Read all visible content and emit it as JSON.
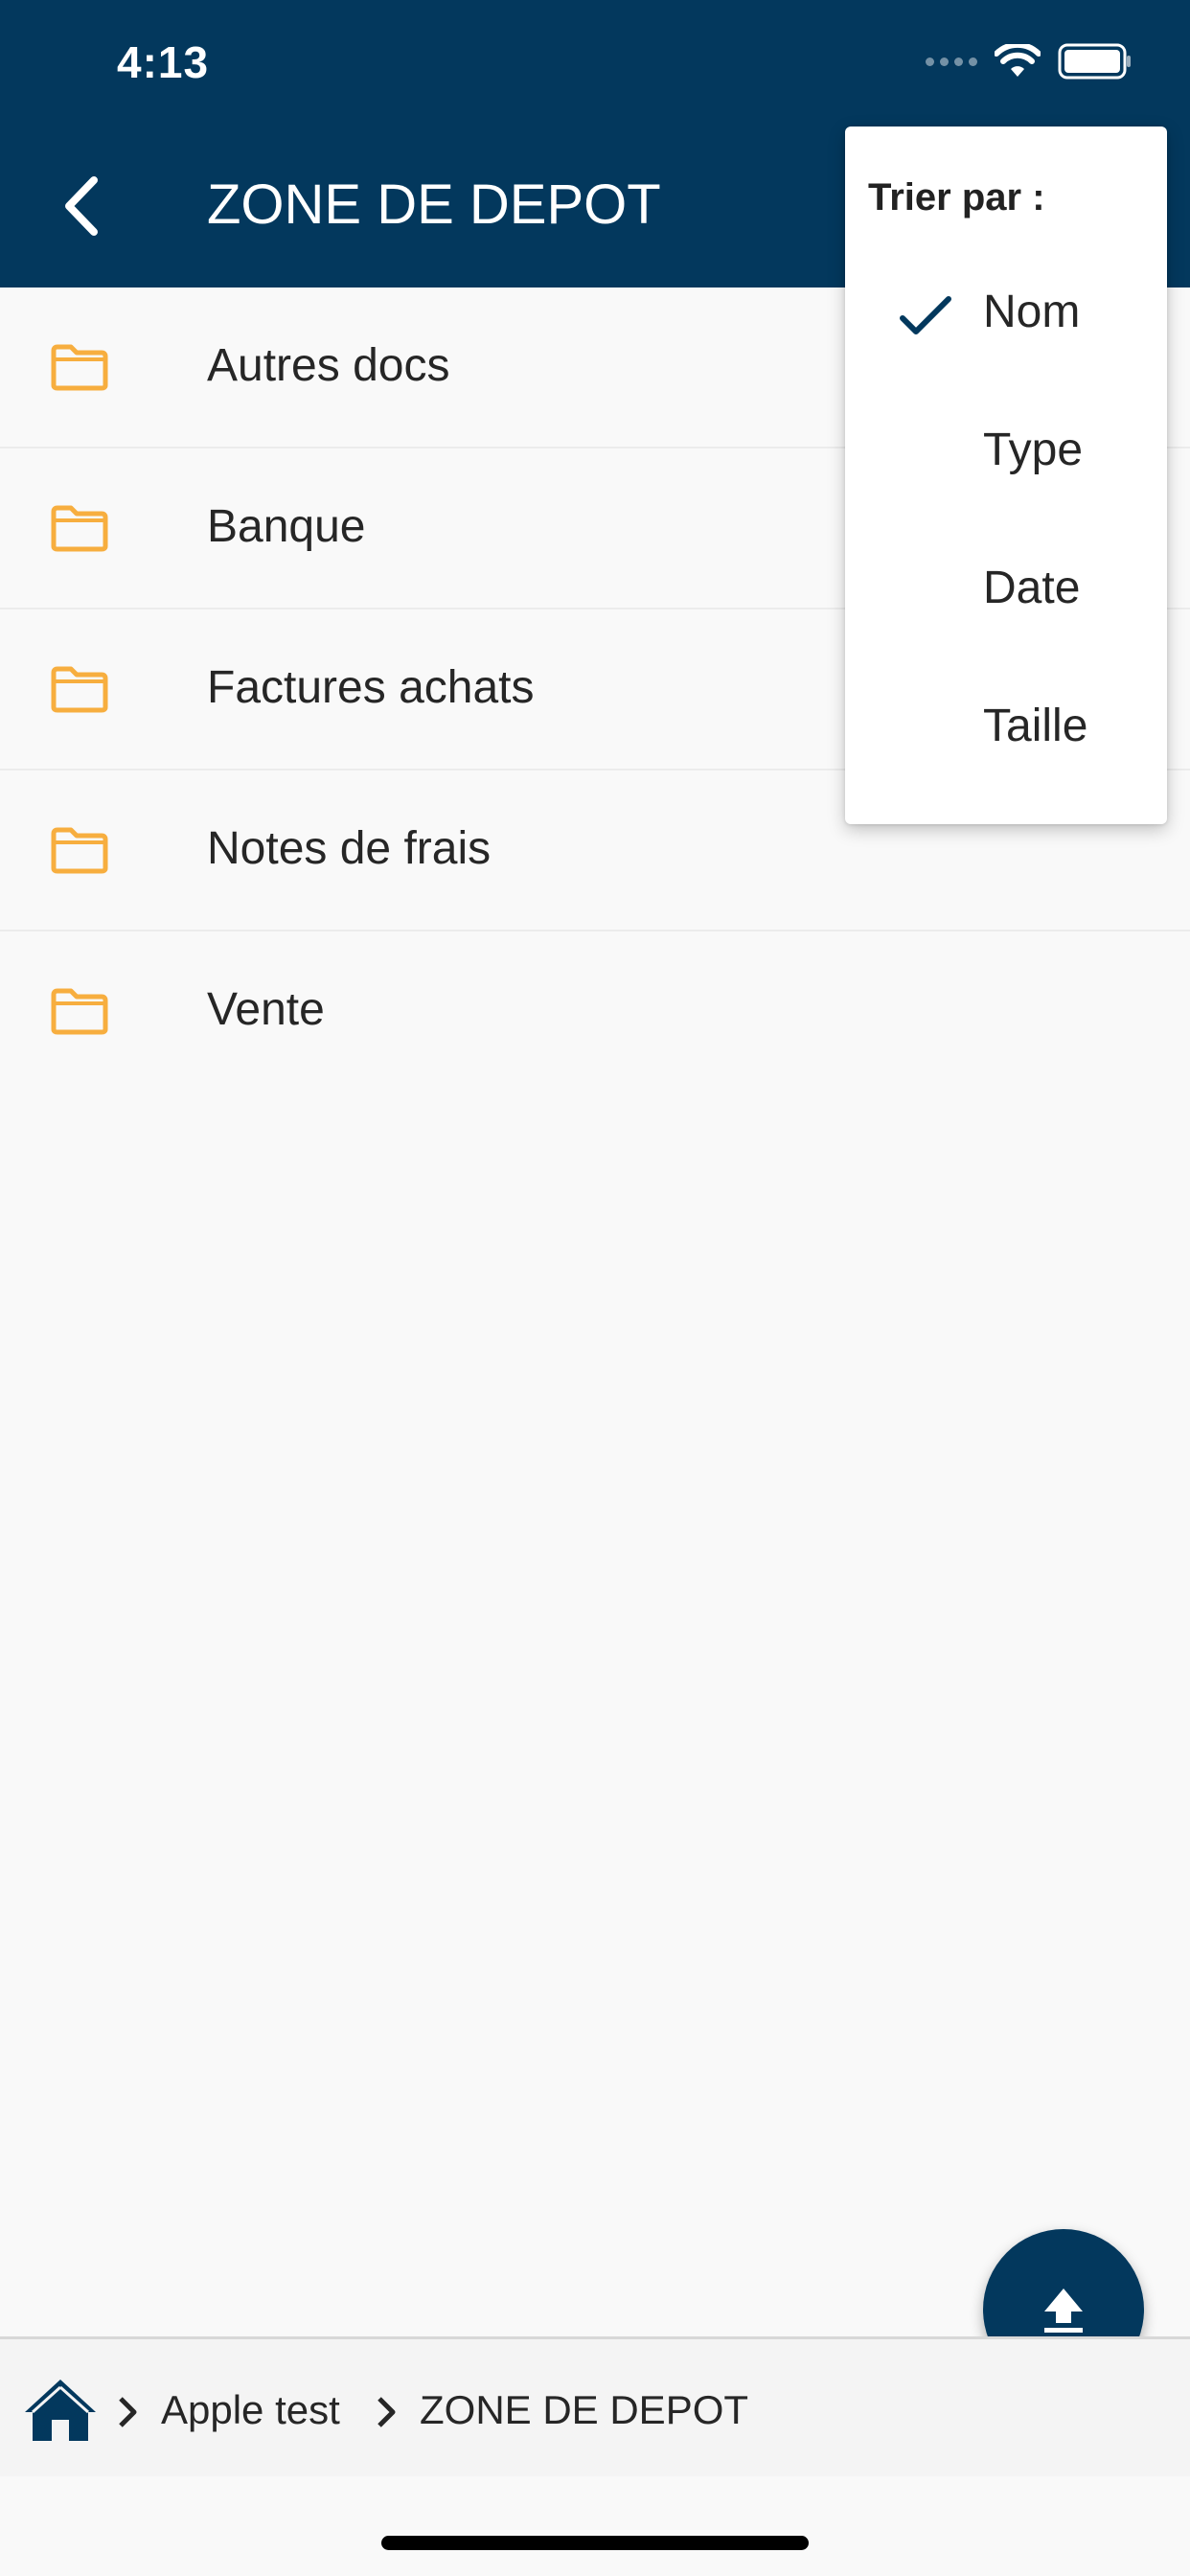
{
  "status_bar": {
    "time": "4:13"
  },
  "header": {
    "title": "ZONE DE DEPOT"
  },
  "folders": [
    {
      "name": "Autres docs"
    },
    {
      "name": "Banque"
    },
    {
      "name": "Factures achats"
    },
    {
      "name": "Notes de frais"
    },
    {
      "name": "Vente"
    }
  ],
  "sort_menu": {
    "title": "Trier par :",
    "options": [
      {
        "label": "Nom",
        "selected": true
      },
      {
        "label": "Type",
        "selected": false
      },
      {
        "label": "Date",
        "selected": false
      },
      {
        "label": "Taille",
        "selected": false
      }
    ]
  },
  "breadcrumb": {
    "items": [
      {
        "label": "Apple test"
      },
      {
        "label": "ZONE DE DEPOT"
      }
    ]
  },
  "colors": {
    "primary": "#03385d",
    "folder": "#f7ae3f",
    "background": "#f9f9f9"
  },
  "icons": {
    "back": "chevron-left-icon",
    "folder": "folder-icon",
    "check": "check-icon",
    "upload": "upload-icon",
    "home": "home-icon",
    "separator": "chevron-right-icon"
  }
}
